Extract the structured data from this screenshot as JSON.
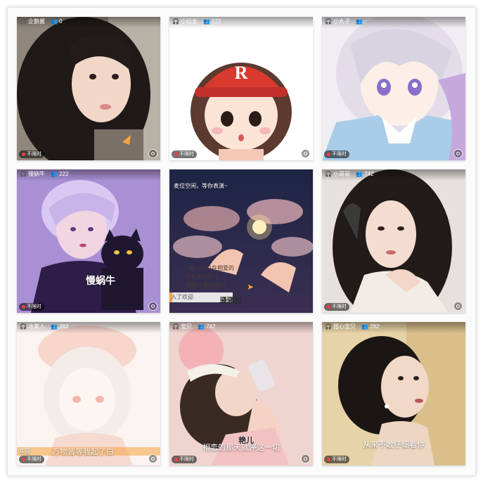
{
  "grid": {
    "badge_label": "不限时",
    "cards": [
      {
        "name": "企鹅酱",
        "count": "0",
        "caption": "",
        "side_label": ""
      },
      {
        "name": "小仙女",
        "count": "222",
        "caption": "",
        "side_label": ""
      },
      {
        "name": "小丸子",
        "count": "",
        "caption": "",
        "side_label": ""
      },
      {
        "name": "慢蜗牛",
        "count": "222",
        "caption": "慢蜗牛",
        "side_label": ""
      },
      {
        "name": "麦位空闲，等你表演~",
        "count": "",
        "caption": "骚骚团",
        "side_label": "入了欢迎",
        "handwriting": [
          "每一个没在相爱的",
          "无关遇到的人",
          "都是不期而遇的"
        ]
      },
      {
        "name": "小哥哥",
        "count": "742",
        "caption": "",
        "side_label": ""
      },
      {
        "name": "冰美人",
        "count": "282",
        "caption": "万物皆等我起了白",
        "side_label": "欢迎"
      },
      {
        "name": "宝贝",
        "count": "742",
        "caption": "相恋的那天就停这一切",
        "sticker": "艳儿",
        "side_label": ""
      },
      {
        "name": "甜心宝贝",
        "count": "282",
        "caption": "从来不敢仔细看你",
        "side_label": ""
      }
    ]
  },
  "colors": {
    "badge_dot": "#ff3b3b",
    "badge_bg": "#00000088",
    "accent_orange": "#f4a340"
  },
  "icons": [
    "headset-icon",
    "people-icon",
    "record-button-icon",
    "paper-plane-icon"
  ]
}
